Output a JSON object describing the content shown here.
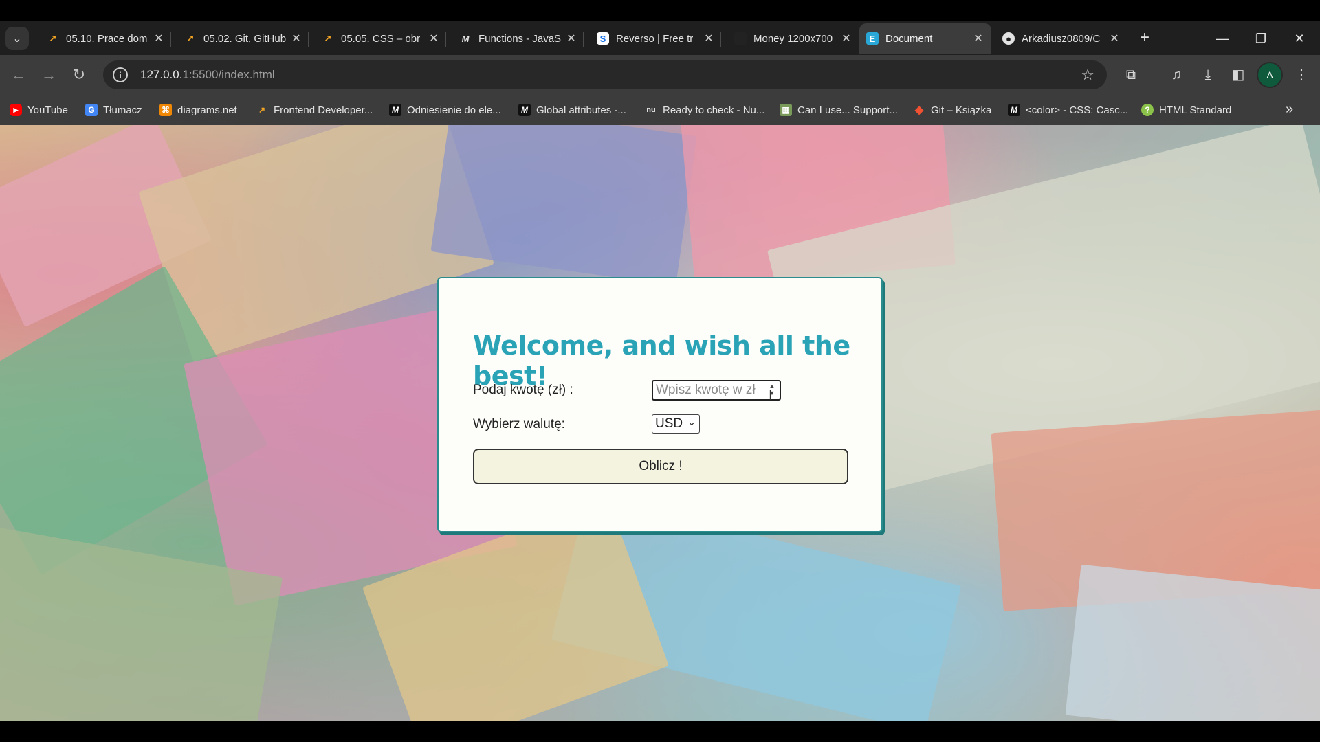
{
  "browser": {
    "tabs": [
      {
        "title": "05.10. Prace dom",
        "active": false
      },
      {
        "title": "05.02. Git, GitHub",
        "active": false
      },
      {
        "title": "05.05. CSS – obr",
        "active": false
      },
      {
        "title": "Functions - JavaS",
        "active": false
      },
      {
        "title": "Reverso | Free tr",
        "active": false
      },
      {
        "title": "Money 1200x700",
        "active": false
      },
      {
        "title": "Document",
        "active": true
      },
      {
        "title": "Arkadiusz0809/C",
        "active": false
      }
    ],
    "url_host": "127.0.0.1",
    "url_rest": ":5500/index.html",
    "avatar_letter": "A",
    "bookmarks": [
      "YouTube",
      "Tłumacz",
      "diagrams.net",
      "Frontend Developer...",
      "Odniesienie do ele...",
      "Global attributes -...",
      "Ready to check - Nu...",
      "Can I use... Support...",
      "Git – Książka",
      "<color> - CSS: Casc...",
      "HTML Standard"
    ]
  },
  "form": {
    "title": "Welcome, and wish all the best!",
    "amount_label": "Podaj kwotę (zł) :",
    "amount_placeholder": "Wpisz kwotę w zł",
    "currency_label": "Wybierz walutę:",
    "currency_selected": "USD",
    "submit_label": "Oblicz !"
  },
  "colors": {
    "accent": "#2aa3b6",
    "card_border": "#2a8c8c",
    "button_bg": "#f3f3df"
  }
}
